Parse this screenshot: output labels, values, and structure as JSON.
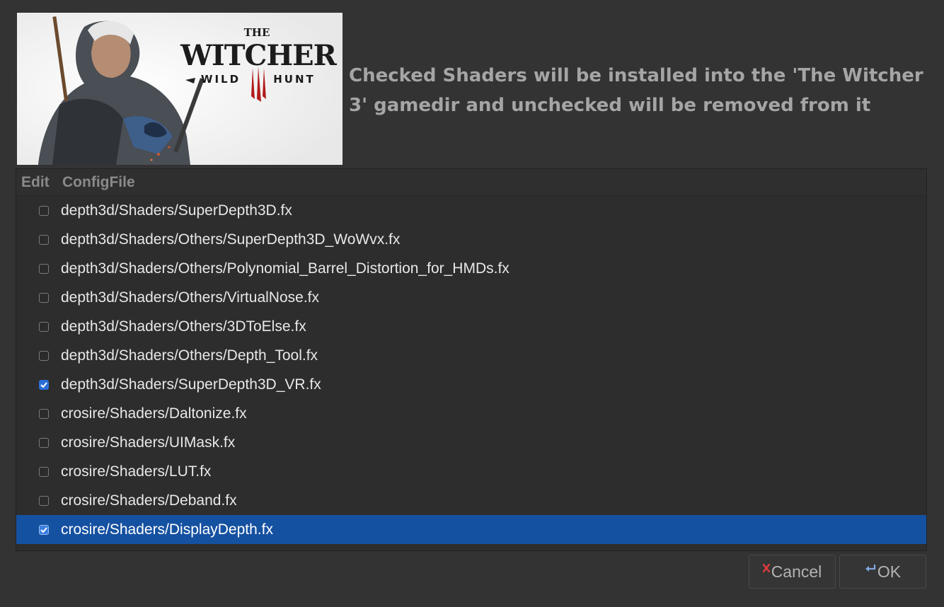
{
  "banner": {
    "title_small": "THE",
    "title_main": "WITCHER",
    "subtitle_left": "WILD",
    "subtitle_right": "HUNT"
  },
  "headline": "Checked Shaders will be installed into the 'The Witcher 3' gamedir and unchecked will be removed from it",
  "table": {
    "columns": [
      "Edit",
      "ConfigFile"
    ],
    "rows": [
      {
        "checked": false,
        "file": "depth3d/Shaders/SuperDepth3D.fx"
      },
      {
        "checked": false,
        "file": "depth3d/Shaders/Others/SuperDepth3D_WoWvx.fx"
      },
      {
        "checked": false,
        "file": "depth3d/Shaders/Others/Polynomial_Barrel_Distortion_for_HMDs.fx"
      },
      {
        "checked": false,
        "file": "depth3d/Shaders/Others/VirtualNose.fx"
      },
      {
        "checked": false,
        "file": "depth3d/Shaders/Others/3DToElse.fx"
      },
      {
        "checked": false,
        "file": "depth3d/Shaders/Others/Depth_Tool.fx"
      },
      {
        "checked": true,
        "file": "depth3d/Shaders/SuperDepth3D_VR.fx"
      },
      {
        "checked": false,
        "file": "crosire/Shaders/Daltonize.fx"
      },
      {
        "checked": false,
        "file": "crosire/Shaders/UIMask.fx"
      },
      {
        "checked": false,
        "file": "crosire/Shaders/LUT.fx"
      },
      {
        "checked": false,
        "file": "crosire/Shaders/Deband.fx"
      },
      {
        "checked": true,
        "file": "crosire/Shaders/DisplayDepth.fx",
        "selected": true
      }
    ]
  },
  "buttons": {
    "cancel": "Cancel",
    "ok": "OK",
    "cancel_icon": "x-icon",
    "ok_icon": "enter-arrow-icon"
  },
  "colors": {
    "background": "#333333",
    "selection": "#1551a1",
    "checkbox_checked": "#2a6fd6",
    "cancel_icon": "#e23b3b",
    "ok_icon": "#7fa8e0"
  }
}
